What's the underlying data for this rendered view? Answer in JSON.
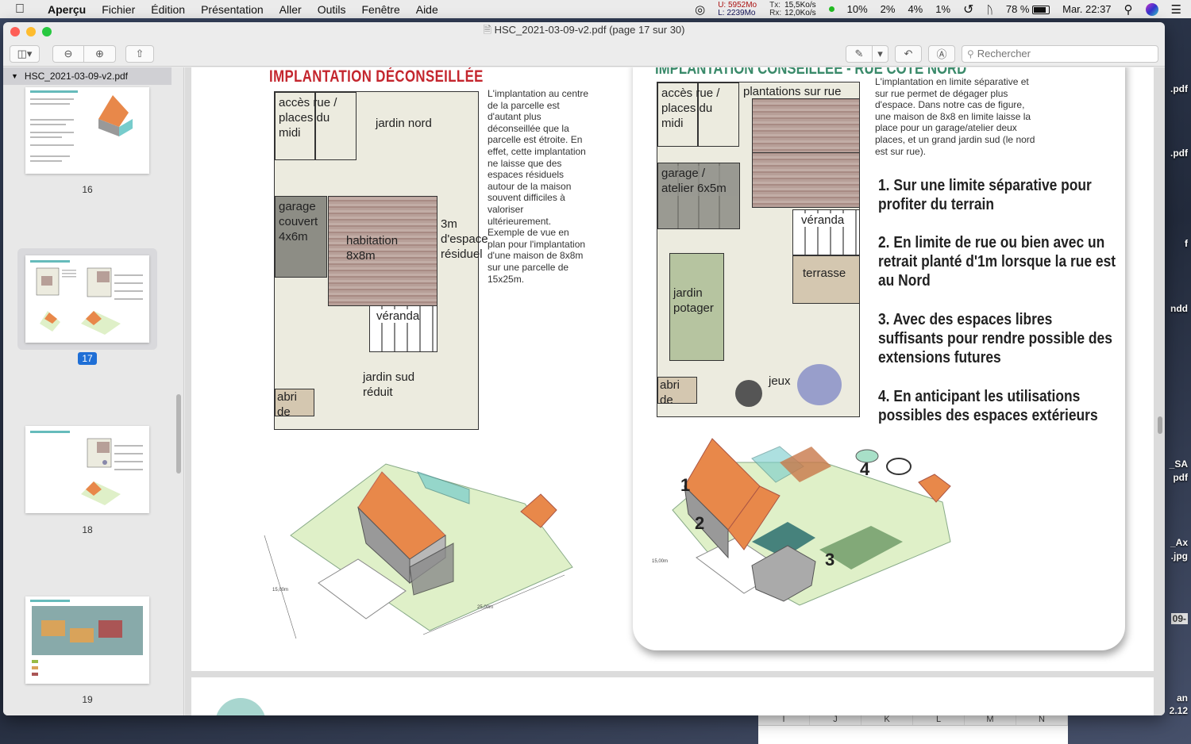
{
  "menubar": {
    "app": "Aperçu",
    "menus": [
      "Fichier",
      "Édition",
      "Présentation",
      "Aller",
      "Outils",
      "Fenêtre",
      "Aide"
    ],
    "mem_u": "U: 5952Mo",
    "mem_l": "L: 2239Mo",
    "net_tx": "Tx:",
    "net_rx": "Rx:",
    "net_tx_val": "15,5Ko/s",
    "net_rx_val": "12,0Ko/s",
    "cpu": [
      "10%",
      "2%",
      "4%",
      "1%"
    ],
    "battery": "78 %",
    "clock": "Mar. 22:37"
  },
  "window": {
    "title": "HSC_2021-03-09-v2.pdf (page 17 sur 30)",
    "search_placeholder": "Rechercher"
  },
  "sidebar": {
    "doc_name": "HSC_2021-03-09-v2.pdf",
    "pages": [
      {
        "label": "16"
      },
      {
        "label": "17",
        "selected": true
      },
      {
        "label": "18"
      },
      {
        "label": "19"
      }
    ]
  },
  "page": {
    "left_title": "IMPLANTATION DÉCONSEILLÉE",
    "left_plan": {
      "acces": "accès rue / places du midi",
      "jardin_nord": "jardin nord",
      "garage": "garage couvert 4x6m",
      "habitation": "habitation 8x8m",
      "espace": "3m d'espace résiduel",
      "veranda": "véranda",
      "jardin_sud": "jardin sud réduit",
      "abri": "abri de jardin"
    },
    "left_paragraph": "L'implantation au centre de la parcelle est d'autant plus déconseillée que la parcelle est étroite. En effet, cette implantation ne laisse que des espaces résiduels autour de la maison souvent difficiles à valoriser ultérieurement. Exemple de vue en plan pour l'implantation d'une maison de 8x8m sur une parcelle de 15x25m.",
    "left_dims": [
      "15,00m",
      "25,00m"
    ],
    "right_title": "IMPLANTATION CONSEILLÉE - RUE CÔTÉ NORD",
    "right_plan": {
      "acces": "accès rue / places du midi",
      "plantations": "plantations sur rue",
      "garage": "garage / atelier 6x5m",
      "veranda": "véranda",
      "terrasse": "terrasse",
      "jardin_potager": "jardin potager",
      "abri": "abri de jardin",
      "jeux": "jeux"
    },
    "right_paragraph": "L'implantation en limite séparative et sur rue permet de dégager plus d'espace. Dans notre cas de figure, une maison de 8x8 en limite laisse la place pour un garage/atelier deux places, et un grand jardin sud (le nord est sur rue).",
    "items": [
      "1. Sur une limite séparative pour profiter du terrain",
      "2. En limite de rue ou bien avec un retrait planté d'1m lorsque la rue est au Nord",
      "3. Avec des espaces libres suffisants pour rendre possible des extensions futures",
      "4. En anticipant les utilisations possibles des espaces extérieurs"
    ],
    "iso_numbers": [
      "1",
      "2",
      "3",
      "4"
    ],
    "right_dim": "15,00m"
  },
  "desktop": {
    "labels": [
      ".pdf",
      ".pdf",
      "f",
      "ndd",
      "_SA",
      "pdf",
      "_Ax",
      ".jpg",
      "09-",
      "an",
      "2.12"
    ],
    "sheet_cols": [
      "I",
      "J",
      "K",
      "L",
      "M",
      "N"
    ]
  },
  "colors": {
    "title_red": "#c4262e",
    "selection_blue": "#1f6fd6",
    "roof_orange": "#e8884a",
    "lawn_green": "#dff0c8"
  }
}
